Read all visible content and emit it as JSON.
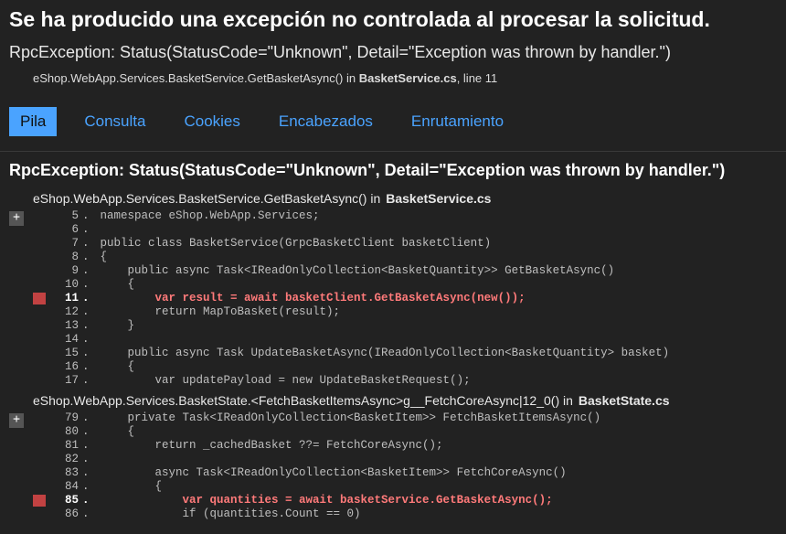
{
  "pageTitle": "Se ha producido una excepción no controlada al procesar la solicitud.",
  "exceptionSummary": "RpcException: Status(StatusCode=\"Unknown\", Detail=\"Exception was thrown by handler.\")",
  "topFrame": {
    "method": "eShop.WebApp.Services.BasketService.GetBasketAsync() in ",
    "file": "BasketService.cs",
    "lineSuffix": ", line 11"
  },
  "tabs": {
    "stack": "Pila",
    "query": "Consulta",
    "cookies": "Cookies",
    "headers": "Encabezados",
    "routing": "Enrutamiento"
  },
  "sectionHeading": "RpcException: Status(StatusCode=\"Unknown\", Detail=\"Exception was thrown by handler.\")",
  "expandGlyph": "+",
  "frames": [
    {
      "method": "eShop.WebApp.Services.BasketService.GetBasketAsync() in ",
      "file": "BasketService.cs",
      "lines": [
        {
          "n": "5",
          "hl": false,
          "t": "namespace eShop.WebApp.Services;"
        },
        {
          "n": "6",
          "hl": false,
          "t": ""
        },
        {
          "n": "7",
          "hl": false,
          "t": "public class BasketService(GrpcBasketClient basketClient)"
        },
        {
          "n": "8",
          "hl": false,
          "t": "{"
        },
        {
          "n": "9",
          "hl": false,
          "t": "    public async Task<IReadOnlyCollection<BasketQuantity>> GetBasketAsync()"
        },
        {
          "n": "10",
          "hl": false,
          "t": "    {"
        },
        {
          "n": "11",
          "hl": true,
          "t": "        var result = await basketClient.GetBasketAsync(new());"
        },
        {
          "n": "12",
          "hl": false,
          "t": "        return MapToBasket(result);"
        },
        {
          "n": "13",
          "hl": false,
          "t": "    }"
        },
        {
          "n": "14",
          "hl": false,
          "t": ""
        },
        {
          "n": "15",
          "hl": false,
          "t": "    public async Task UpdateBasketAsync(IReadOnlyCollection<BasketQuantity> basket)"
        },
        {
          "n": "16",
          "hl": false,
          "t": "    {"
        },
        {
          "n": "17",
          "hl": false,
          "t": "        var updatePayload = new UpdateBasketRequest();"
        }
      ]
    },
    {
      "method": "eShop.WebApp.Services.BasketState.<FetchBasketItemsAsync>g__FetchCoreAsync|12_0() in ",
      "file": "BasketState.cs",
      "lines": [
        {
          "n": "79",
          "hl": false,
          "t": "    private Task<IReadOnlyCollection<BasketItem>> FetchBasketItemsAsync()"
        },
        {
          "n": "80",
          "hl": false,
          "t": "    {"
        },
        {
          "n": "81",
          "hl": false,
          "t": "        return _cachedBasket ??= FetchCoreAsync();"
        },
        {
          "n": "82",
          "hl": false,
          "t": ""
        },
        {
          "n": "83",
          "hl": false,
          "t": "        async Task<IReadOnlyCollection<BasketItem>> FetchCoreAsync()"
        },
        {
          "n": "84",
          "hl": false,
          "t": "        {"
        },
        {
          "n": "85",
          "hl": true,
          "t": "            var quantities = await basketService.GetBasketAsync();"
        },
        {
          "n": "86",
          "hl": false,
          "t": "            if (quantities.Count == 0)"
        }
      ]
    }
  ]
}
